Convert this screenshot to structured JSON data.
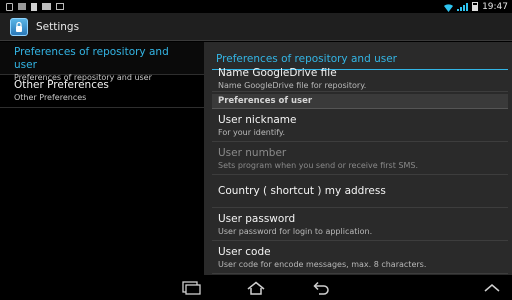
{
  "status_bar": {
    "time": "19:47",
    "icons": [
      "usb-icon",
      "box-icon",
      "document-icon",
      "image-icon",
      "bag-icon",
      "wifi-icon",
      "signal-icon",
      "battery-icon"
    ]
  },
  "action_bar": {
    "title": "Settings",
    "icon": "lock-app-icon"
  },
  "left_pane": {
    "headers": [
      {
        "title": "Preferences of repository and user",
        "summary": "Preferences of repository and user",
        "selected": true
      },
      {
        "title": "Other Preferences",
        "summary": "Other Preferences",
        "selected": false
      }
    ]
  },
  "right_pane": {
    "title": "Preferences of repository and user",
    "first_item": {
      "title": "Name GoogleDrive file",
      "summary": "Name GoogleDrive file for repository."
    },
    "category": "Preferences of user",
    "items": [
      {
        "title": "User nickname",
        "summary": "For your identify.",
        "enabled": true
      },
      {
        "title": "User number",
        "summary": "Sets program when you send or receive first SMS.",
        "enabled": false
      },
      {
        "title": "Country ( shortcut ) my address",
        "summary": "",
        "enabled": true
      },
      {
        "title": "User password",
        "summary": "User password for login to application.",
        "enabled": true
      },
      {
        "title": "User code",
        "summary": "User code for encode messages, max. 8 characters.",
        "enabled": true
      }
    ]
  },
  "nav_bar": {
    "buttons": [
      "recent-apps-icon",
      "home-icon",
      "back-icon",
      "up-arrow-icon"
    ]
  },
  "colors": {
    "accent": "#33b5e5",
    "pane_bg": "#2a2a2a",
    "category_bg": "#3a3a3a"
  }
}
